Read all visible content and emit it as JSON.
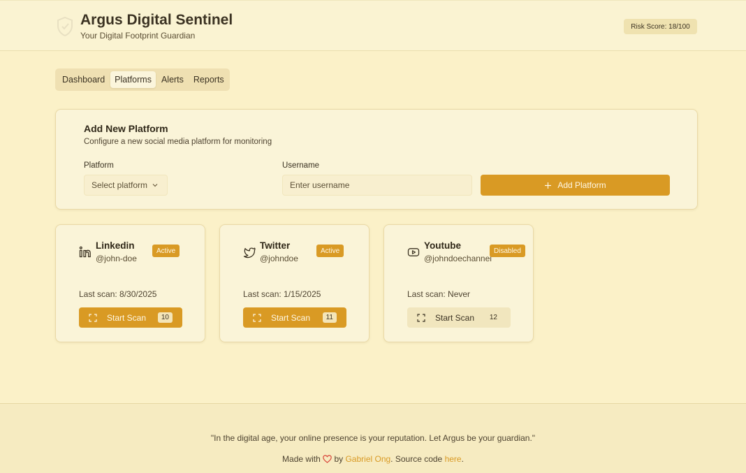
{
  "header": {
    "title": "Argus Digital Sentinel",
    "subtitle": "Your Digital Footprint Guardian",
    "risk_score": "Risk Score: 18/100"
  },
  "nav": {
    "tabs": [
      {
        "label": "Dashboard",
        "active": false
      },
      {
        "label": "Platforms",
        "active": true
      },
      {
        "label": "Alerts",
        "active": false
      },
      {
        "label": "Reports",
        "active": false
      }
    ]
  },
  "add_platform": {
    "title": "Add New Platform",
    "description": "Configure a new social media platform for monitoring",
    "platform_label": "Platform",
    "platform_placeholder": "Select platform",
    "username_label": "Username",
    "username_placeholder": "Enter username",
    "button_label": "Add Platform"
  },
  "platforms": [
    {
      "name": "Linkedin",
      "handle": "@john-doe",
      "status": "Active",
      "last_scan": "Last scan: 8/30/2025",
      "scan_label": "Start Scan",
      "scan_count": "10",
      "icon": "linkedin-icon",
      "enabled": true
    },
    {
      "name": "Twitter",
      "handle": "@johndoe",
      "status": "Active",
      "last_scan": "Last scan: 1/15/2025",
      "scan_label": "Start Scan",
      "scan_count": "11",
      "icon": "twitter-icon",
      "enabled": true
    },
    {
      "name": "Youtube",
      "handle": "@johndoechannel",
      "status": "Disabled",
      "last_scan": "Last scan: Never",
      "scan_label": "Start Scan",
      "scan_count": "12",
      "icon": "youtube-icon",
      "enabled": false
    }
  ],
  "footer": {
    "quote": "\"In the digital age, your online presence is your reputation. Let Argus be your guardian.\"",
    "made_with": "Made with",
    "by": "by",
    "author": "Gabriel Ong",
    "source_text": ". Source code",
    "source_link": "here",
    "period": "."
  },
  "colors": {
    "accent": "#d99a24",
    "background": "#fbf1c8",
    "card": "#faf4d8"
  }
}
